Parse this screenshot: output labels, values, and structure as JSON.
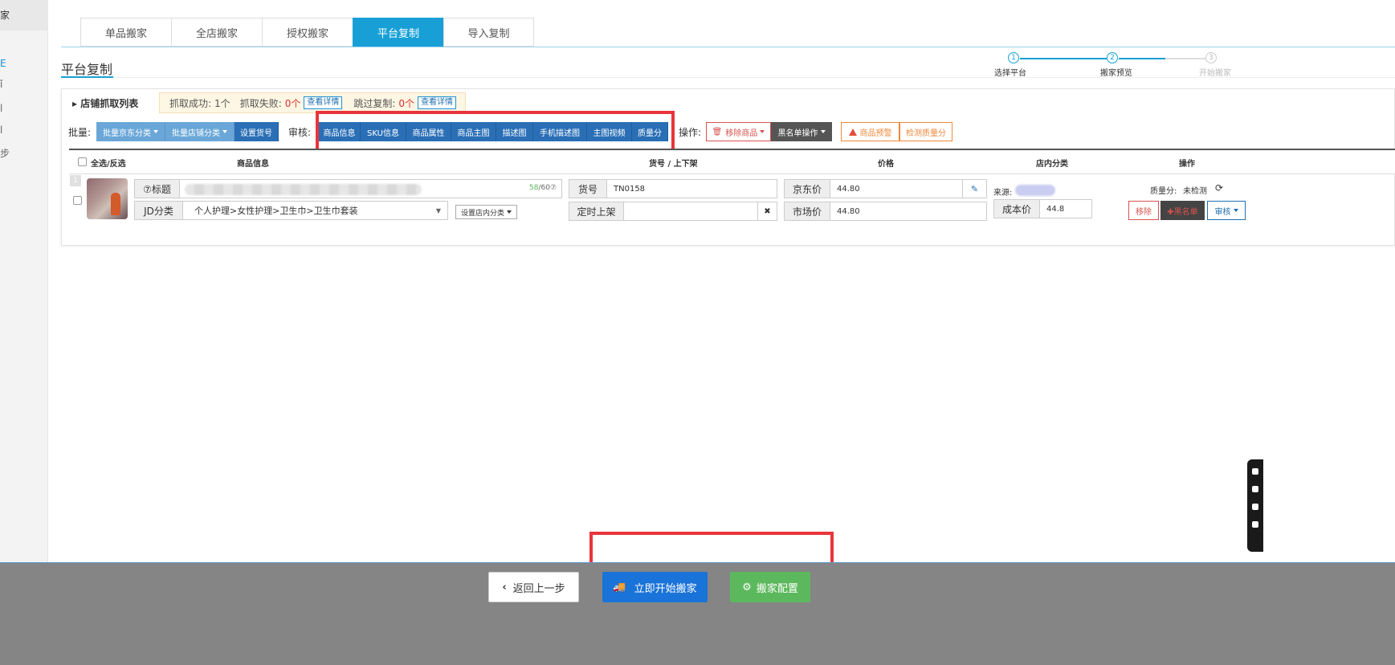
{
  "sidebar": {
    "head": "家",
    "items": [
      "家",
      "E",
      "ǐ",
      "l",
      "步"
    ]
  },
  "tabs": [
    {
      "label": "单品搬家",
      "active": false
    },
    {
      "label": "全店搬家",
      "active": false
    },
    {
      "label": "授权搬家",
      "active": false
    },
    {
      "label": "平台复制",
      "active": true
    },
    {
      "label": "导入复制",
      "active": false
    }
  ],
  "page": {
    "title": "平台复制"
  },
  "steps": [
    {
      "num": "1",
      "label": "选择平台",
      "done": true
    },
    {
      "num": "2",
      "label": "搬家预览",
      "done": true
    },
    {
      "num": "3",
      "label": "开始搬家",
      "done": false
    }
  ],
  "list": {
    "title": "店铺抓取列表",
    "success_label": "抓取成功: ",
    "success_value": "1个",
    "fail_label": "抓取失败: ",
    "fail_value": "0个",
    "skip_label": "跳过复制: ",
    "skip_value": "0个",
    "detail_label": "查看详情"
  },
  "toolbar": {
    "batch_label": "批量:",
    "batch_jd_cat": "批量京东分类",
    "batch_shop_cat": "批量店铺分类",
    "set_sku": "设置货号",
    "audit_label": "审核:",
    "audit_items": [
      "商品信息",
      "SKU信息",
      "商品属性",
      "商品主图",
      "描述图",
      "手机描述图",
      "主图视频",
      "质量分"
    ],
    "op_label": "操作:",
    "remove_goods": "移除商品",
    "blacklist_op": "黑名单操作",
    "goods_warning": "商品预警",
    "check_quality": "检测质量分"
  },
  "table": {
    "headers": {
      "select_all": "全选/反选",
      "goods_info": "商品信息",
      "sku_shelf": "货号 / 上下架",
      "price": "价格",
      "shop_cat": "店内分类",
      "ops": "操作"
    },
    "rows": [
      {
        "index": "1",
        "title_label": "⑦标题",
        "title_count": "58",
        "title_max": "/60⑦",
        "jd_cat_label": "JD分类",
        "jd_cat_value": "个人护理>女性护理>卫生巾>卫生巾套装",
        "set_shop_cat": "设置店内分类",
        "sku_label": "货号",
        "sku_value": "TN0158",
        "shelf_label": "定时上架",
        "shelf_value": "",
        "clear_icon": "✖",
        "jd_price_label": "京东价",
        "jd_price": "44.80",
        "market_price_label": "市场价",
        "market_price": "44.80",
        "source_label": "来源:",
        "cost_label": "成本价",
        "cost_value": "44.8",
        "quality_label": "质量分:",
        "quality_value": "未检测",
        "btn_remove": "移除",
        "btn_blacklist": "✚黑名单",
        "btn_audit": "审核"
      }
    ]
  },
  "footer": {
    "back": "返回上一步",
    "start": "立即开始搬家",
    "config": "搬家配置"
  },
  "colors": {
    "accent": "#18a0d6",
    "primary": "#1a73d8",
    "success": "#5cb85c",
    "danger": "#d9534f",
    "warning": "#f0883a",
    "highlight": "#e8353b"
  }
}
